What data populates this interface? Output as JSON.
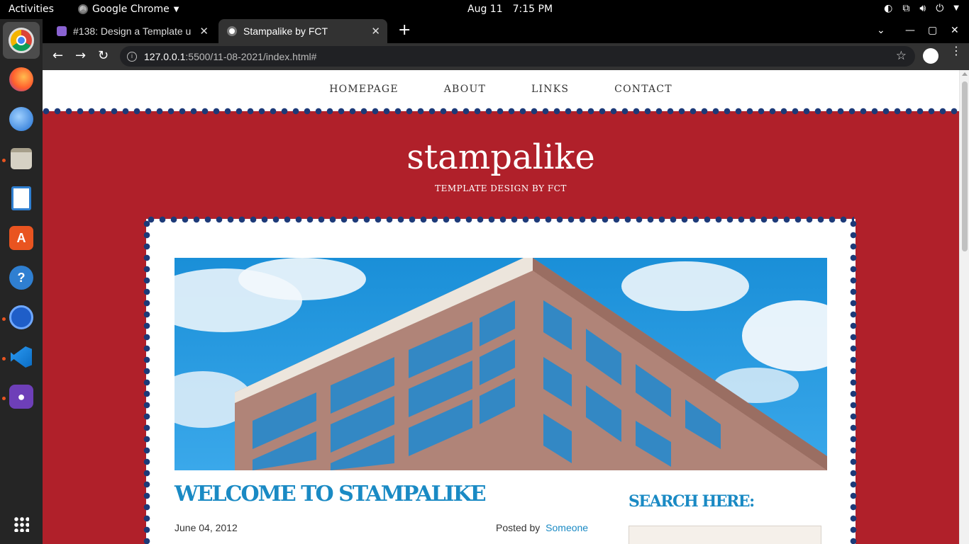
{
  "system": {
    "activities": "Activities",
    "app_name": "Google Chrome",
    "date": "Aug 11",
    "time": "7:15 PM"
  },
  "browser": {
    "tabs": [
      {
        "title": "#138: Design a Template u"
      },
      {
        "title": "Stampalike by FCT"
      }
    ],
    "url_host": "127.0.0.1",
    "url_rest": ":5500/11-08-2021/index.html#"
  },
  "site": {
    "nav": [
      "HOMEPAGE",
      "ABOUT",
      "LINKS",
      "CONTACT"
    ],
    "title": "stampalike",
    "tagline": "TEMPLATE DESIGN BY FCT",
    "post": {
      "title": "WELCOME TO STAMPALIKE",
      "date": "June 04, 2012",
      "posted_by_label": "Posted by",
      "author": "Someone"
    },
    "sidebar": {
      "search_title": "SEARCH HERE:"
    }
  },
  "colors": {
    "red": "#b0202a",
    "dot_blue": "#1d3a78",
    "link_blue": "#1a8ac4"
  },
  "dock_icons": [
    "chrome-icon",
    "firefox-icon",
    "thunderbird-icon",
    "files-icon",
    "writer-icon",
    "software-icon",
    "help-icon",
    "timer-icon",
    "vscode-icon",
    "github-icon",
    "app-grid-icon"
  ]
}
